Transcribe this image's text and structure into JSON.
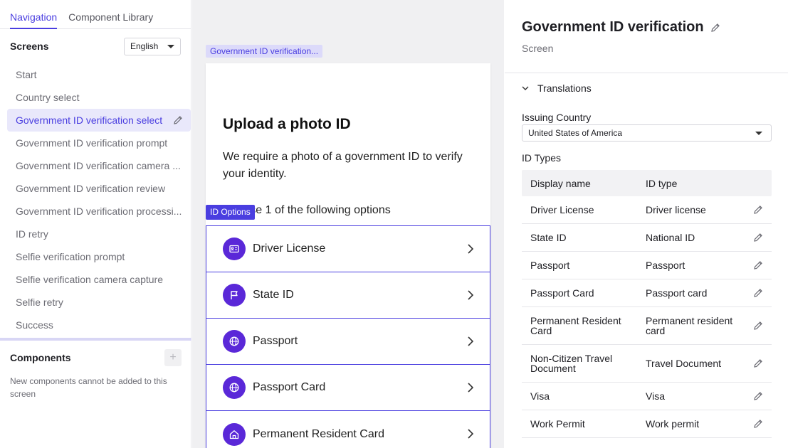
{
  "nav": {
    "tabs": [
      {
        "label": "Navigation",
        "active": true
      },
      {
        "label": "Component Library",
        "active": false
      }
    ],
    "screens_title": "Screens",
    "language": "English",
    "screens": [
      "Start",
      "Country select",
      "Government ID verification select",
      "Government ID verification prompt",
      "Government ID verification camera ...",
      "Government ID verification review",
      "Government ID verification processi...",
      "ID retry",
      "Selfie verification prompt",
      "Selfie verification camera capture",
      "Selfie retry",
      "Success"
    ],
    "active_screen_index": 2,
    "components_title": "Components",
    "components_add": "+",
    "components_note": "New components cannot be added to this screen"
  },
  "canvas": {
    "screen_tag": "Government ID verification...",
    "heading": "Upload a photo ID",
    "description": "We require a photo of a government ID to verify your identity.",
    "choose_text": "Choose 1 of the following options",
    "options_tag": "ID Options",
    "options": [
      {
        "label": "Driver License",
        "icon": "id-card-icon"
      },
      {
        "label": "State ID",
        "icon": "flag-icon"
      },
      {
        "label": "Passport",
        "icon": "globe-icon"
      },
      {
        "label": "Passport Card",
        "icon": "globe-icon"
      },
      {
        "label": "Permanent Resident Card",
        "icon": "home-icon"
      }
    ]
  },
  "inspector": {
    "title": "Government ID verification",
    "subtitle": "Screen",
    "section": "Translations",
    "issuing_country_label": "Issuing Country",
    "issuing_country_value": "United States of America",
    "id_types_label": "ID Types",
    "columns": [
      "Display name",
      "ID type"
    ],
    "rows": [
      {
        "display": "Driver License",
        "type": "Driver license"
      },
      {
        "display": "State ID",
        "type": "National ID"
      },
      {
        "display": "Passport",
        "type": "Passport"
      },
      {
        "display": "Passport Card",
        "type": "Passport card"
      },
      {
        "display": "Permanent Resident Card",
        "type": "Permanent resident card"
      },
      {
        "display": "Non-Citizen Travel Document",
        "type": "Travel Document"
      },
      {
        "display": "Visa",
        "type": "Visa"
      },
      {
        "display": "Work Permit",
        "type": "Work permit"
      }
    ]
  },
  "colors": {
    "accent": "#4a3ee0",
    "accent_light": "#e9e8fb",
    "icon_bg": "#5a28d8"
  }
}
